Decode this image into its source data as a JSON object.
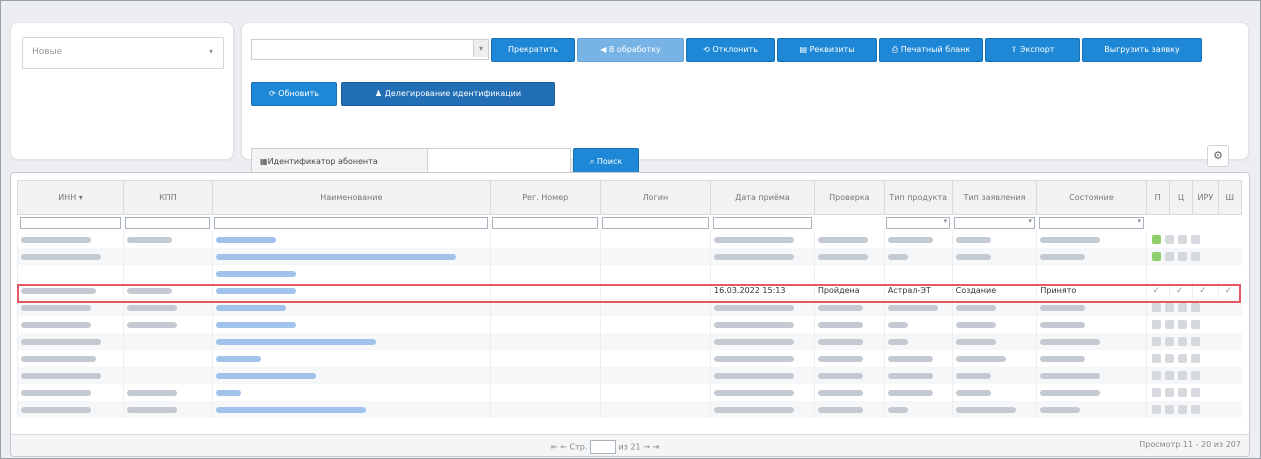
{
  "filter_select": {
    "value": "Новые",
    "chevron": "▾"
  },
  "combo": {
    "value": "",
    "button": "▾"
  },
  "toolbar": {
    "stop": "Прекратить",
    "to_processing": "В обработку",
    "reject": "Отклонить",
    "requisites": "Реквизиты",
    "print_form": "Печатный бланк",
    "export": "Экспорт",
    "upload_request": "Выгрузить заявку",
    "refresh": "Обновить",
    "delegate_ident": "Делегирование идентификации",
    "search": "Поиск"
  },
  "subscriber_id": {
    "label": "Идентификатор абонента",
    "value": ""
  },
  "gear": "⚙",
  "grid": {
    "columns": [
      "ИНН ▾",
      "КПП",
      "Наименование",
      "Рег. Номер",
      "Логин",
      "Дата приёма",
      "Проверка",
      "Тип продукта",
      "Тип заявления",
      "Состояние",
      "П",
      "Ц",
      "ИРУ",
      "Ш"
    ],
    "selected_row": {
      "inn": "",
      "kpp": "",
      "name": "",
      "reg": "",
      "login": "",
      "date": "16.03.2022 15:13",
      "check": "Пройдена",
      "product": "Астрал-ЭТ",
      "req_type": "Создание",
      "state": "Принято"
    },
    "check_glyph": "✓"
  },
  "pager": {
    "nav_left": "⇤ ←",
    "page_label": "Стр.",
    "page_value": "",
    "of_label": "из 21",
    "nav_right": "→ ⇥",
    "summary": "Просмотр 11 - 20 из 207"
  }
}
